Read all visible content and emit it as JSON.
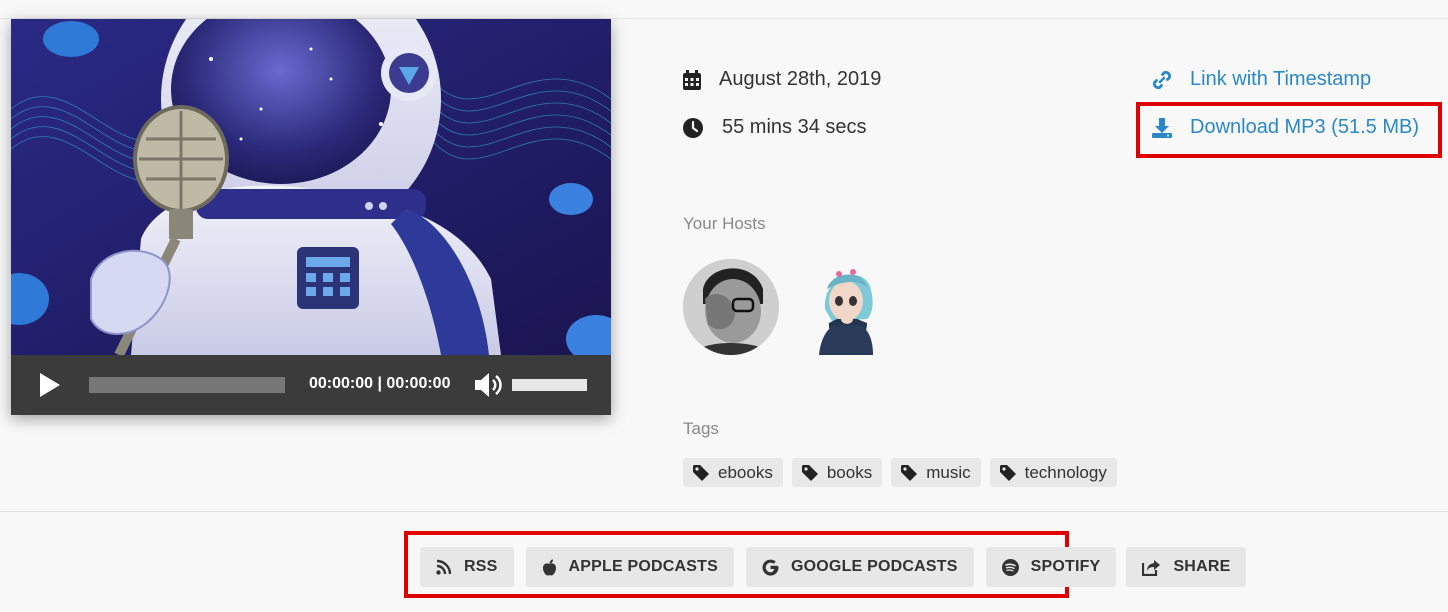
{
  "player": {
    "time_display": "00:00:00 | 00:00:00"
  },
  "episode": {
    "date": "August 28th, 2019",
    "duration": "55 mins 34 secs",
    "link_timestamp_label": "Link with Timestamp",
    "download_label": "Download MP3 (51.5 MB)"
  },
  "hosts": {
    "heading": "Your Hosts",
    "items": [
      {
        "avatar_style": "photo-grayscale"
      },
      {
        "avatar_style": "cartoon-character"
      }
    ]
  },
  "tags": {
    "heading": "Tags",
    "items": [
      "ebooks",
      "books",
      "music",
      "technology"
    ]
  },
  "subscribe": {
    "rss": "RSS",
    "apple": "APPLE PODCASTS",
    "google": "GOOGLE PODCASTS",
    "spotify": "SPOTIFY",
    "share": "SHARE"
  },
  "colors": {
    "link": "#2a88c8",
    "highlight": "#e00000",
    "player_bg": "#3b3b3b"
  },
  "icons": {
    "date": "calendar-icon",
    "duration": "clock-icon",
    "timestamp": "link-icon",
    "download": "download-icon",
    "tag": "tag-icon",
    "rss": "rss-icon",
    "apple": "apple-icon",
    "google": "google-icon",
    "spotify": "spotify-icon",
    "share": "share-icon"
  }
}
